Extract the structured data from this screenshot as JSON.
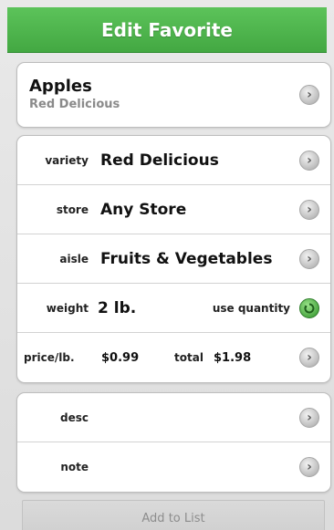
{
  "header": {
    "title": "Edit Favorite"
  },
  "item": {
    "name": "Apples",
    "subtitle": "Red Delicious"
  },
  "details": {
    "variety": {
      "label": "variety",
      "value": "Red Delicious"
    },
    "store": {
      "label": "store",
      "value": "Any Store"
    },
    "aisle": {
      "label": "aisle",
      "value": "Fruits & Vegetables"
    },
    "weight": {
      "label": "weight",
      "value": "2 lb.",
      "toggle_label": "use quantity"
    },
    "price": {
      "label": "price/lb.",
      "value": "$0.99",
      "total_label": "total",
      "total_value": "$1.98"
    }
  },
  "extras": {
    "desc": {
      "label": "desc"
    },
    "note": {
      "label": "note"
    }
  },
  "actions": {
    "add_to_list": "Add to List"
  },
  "colors": {
    "header_green": "#4bb548",
    "toggle_green": "#4eaa45"
  },
  "icons": {
    "row_arrow": "chevron-right-icon",
    "quantity_toggle": "quantity-toggle-icon"
  }
}
